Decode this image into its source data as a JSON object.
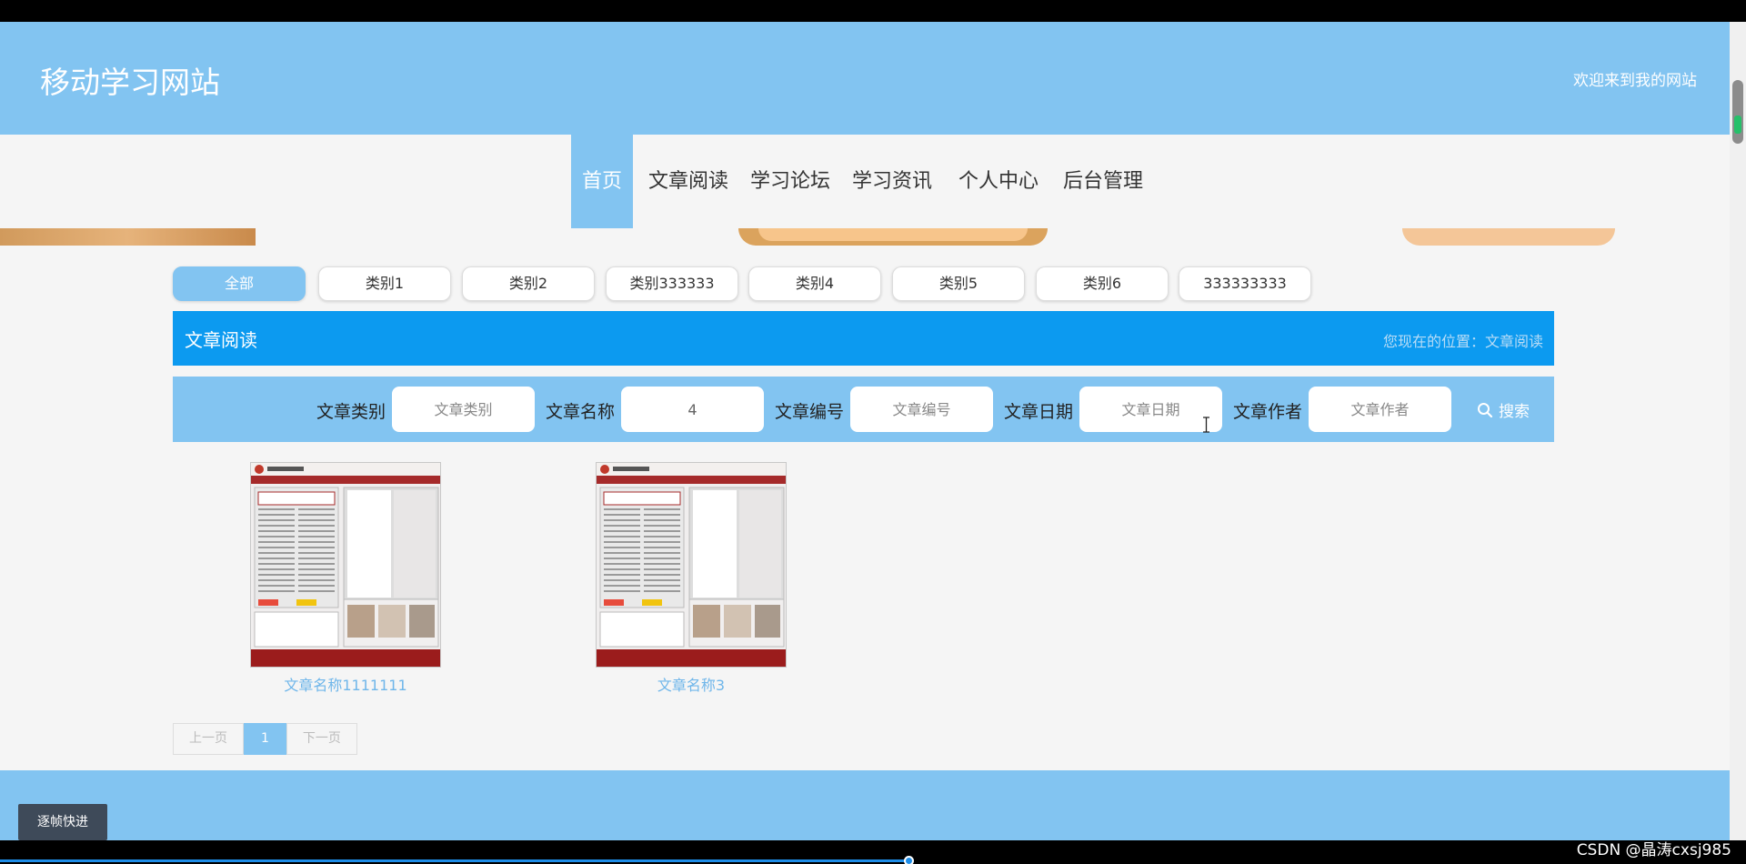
{
  "header": {
    "site_title": "移动学习网站",
    "welcome": "欢迎来到我的网站"
  },
  "nav": {
    "items": [
      {
        "label": "首页",
        "active": true
      },
      {
        "label": "文章阅读"
      },
      {
        "label": "学习论坛"
      },
      {
        "label": "学习资讯"
      },
      {
        "label": "个人中心"
      },
      {
        "label": "后台管理"
      }
    ]
  },
  "categories": [
    "全部",
    "类别1",
    "类别2",
    "类别333333",
    "类别4",
    "类别5",
    "类别6",
    "333333333"
  ],
  "section": {
    "title": "文章阅读",
    "breadcrumb": "您现在的位置：文章阅读"
  },
  "search": {
    "fields": [
      {
        "label": "文章类别",
        "placeholder": "文章类别",
        "value": ""
      },
      {
        "label": "文章名称",
        "placeholder": "文章名称",
        "value": "4"
      },
      {
        "label": "文章编号",
        "placeholder": "文章编号",
        "value": ""
      },
      {
        "label": "文章日期",
        "placeholder": "文章日期",
        "value": ""
      },
      {
        "label": "文章作者",
        "placeholder": "文章作者",
        "value": ""
      }
    ],
    "button_label": "搜索"
  },
  "articles": [
    {
      "title": "文章名称1111111"
    },
    {
      "title": "文章名称3"
    }
  ],
  "pagination": {
    "prev": "上一页",
    "current": "1",
    "next": "下一页"
  },
  "overlay": {
    "frame_button": "逐帧快进",
    "watermark": "CSDN @晶涛cxsj985"
  },
  "colors": {
    "primary": "#82c4f1",
    "section_bar": "#0c9af0",
    "link": "#6fb6ea"
  }
}
